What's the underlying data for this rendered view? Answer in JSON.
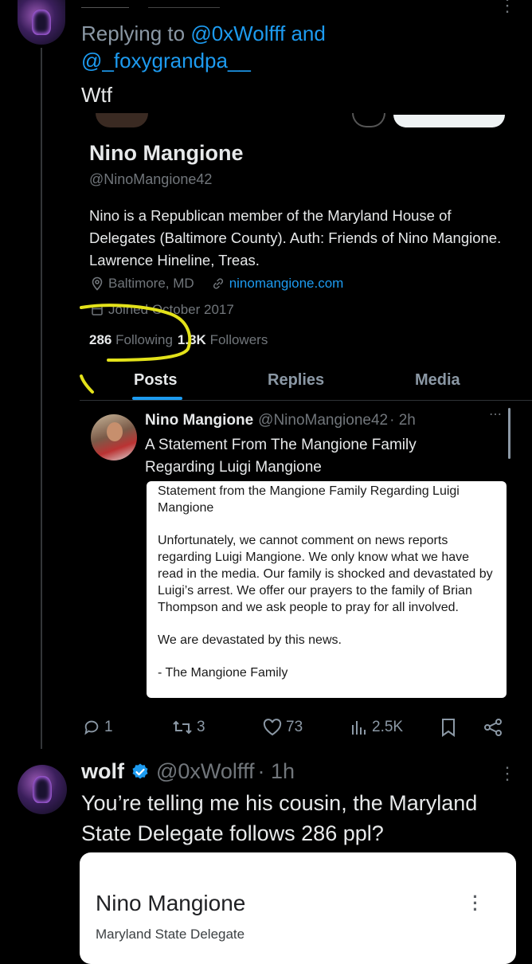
{
  "reply": {
    "prefix": "Replying to",
    "user1": "@0xWolfff",
    "conj": "and",
    "user2": "@_foxygrandpa__",
    "text": "Wtf"
  },
  "profile": {
    "name": "Nino Mangione",
    "handle": "@NinoMangione42",
    "bio": "Nino is a Republican member of the Maryland House of Delegates (Baltimore County). Auth: Friends of Nino Mangione. Lawrence Hineline, Treas.",
    "location": "Baltimore, MD",
    "website": "ninomangione.com",
    "joined": "Joined October 2017",
    "following_count": "286",
    "following_label": "Following",
    "followers_count": "1.3K",
    "followers_label": "Followers",
    "tabs": [
      "Posts",
      "Replies",
      "Media"
    ],
    "active_tab": "Posts"
  },
  "inner_post": {
    "name": "Nino Mangione",
    "handle": "@NinoMangione42",
    "time": "· 2h",
    "text": "A Statement From The Mangione Family Regarding Luigi Mangione",
    "statement": {
      "title": "Statement from the Mangione Family Regarding Luigi Mangione",
      "para1": "Unfortunately, we cannot comment on news reports regarding Luigi Mangione.  We only know what we have read in the media.  Our family is shocked and devastated by Luigi’s arrest.  We offer our prayers to the family of Brian Thompson and we ask people to pray for all involved.",
      "para2": "We are devastated by this news.",
      "sign": "- The Mangione Family"
    },
    "stats": {
      "replies": "1",
      "reposts": "3",
      "likes": "73",
      "views": "2.5K"
    }
  },
  "bottom_post": {
    "name": "wolf",
    "handle": "@0xWolfff",
    "time": "· 1h",
    "text": "You’re telling me his cousin, the Maryland State Delegate follows 286 ppl?",
    "card": {
      "title": "Nino Mangione",
      "subtitle": "Maryland State Delegate"
    }
  },
  "colors": {
    "background": "#000000",
    "link_blue": "#1d9bf0",
    "muted": "#71767b",
    "highlight_yellow": "#e3e21a"
  }
}
